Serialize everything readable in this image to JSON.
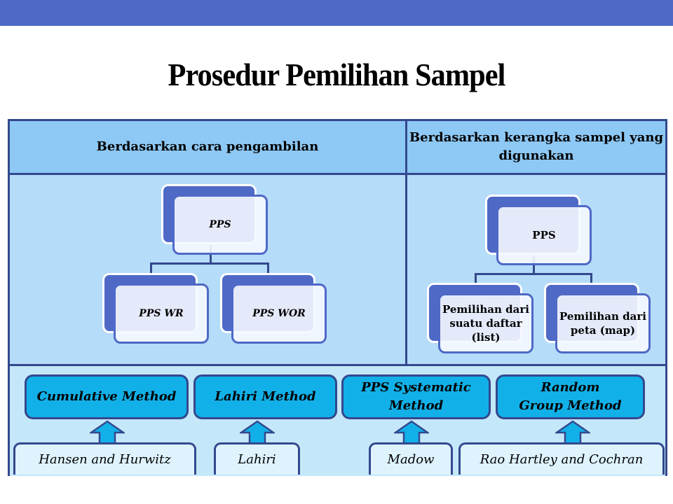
{
  "slide": {
    "title": "Prosedur Pemilihan Sampel",
    "accent_color": "#4f69c6"
  },
  "table": {
    "headers": {
      "left": "Berdasarkan cara pengambilan",
      "right": "Berdasarkan kerangka sampel yang digunakan"
    },
    "left_tree": {
      "root": "PPS",
      "children": [
        "PPS WR",
        "PPS WOR"
      ]
    },
    "right_tree": {
      "root": "PPS",
      "children": [
        "Pemilihan dari suatu daftar (list)",
        "Pemilihan dari peta (map)"
      ]
    },
    "methods": [
      {
        "name": "Cumulative Method",
        "author": "Hansen and Hurwitz"
      },
      {
        "name": "Lahiri Method",
        "author": "Lahiri"
      },
      {
        "name": "PPS Systematic Method",
        "author": "Madow"
      },
      {
        "name": "Random Group Method",
        "author": "Rao Hartley and Cochran"
      }
    ]
  }
}
